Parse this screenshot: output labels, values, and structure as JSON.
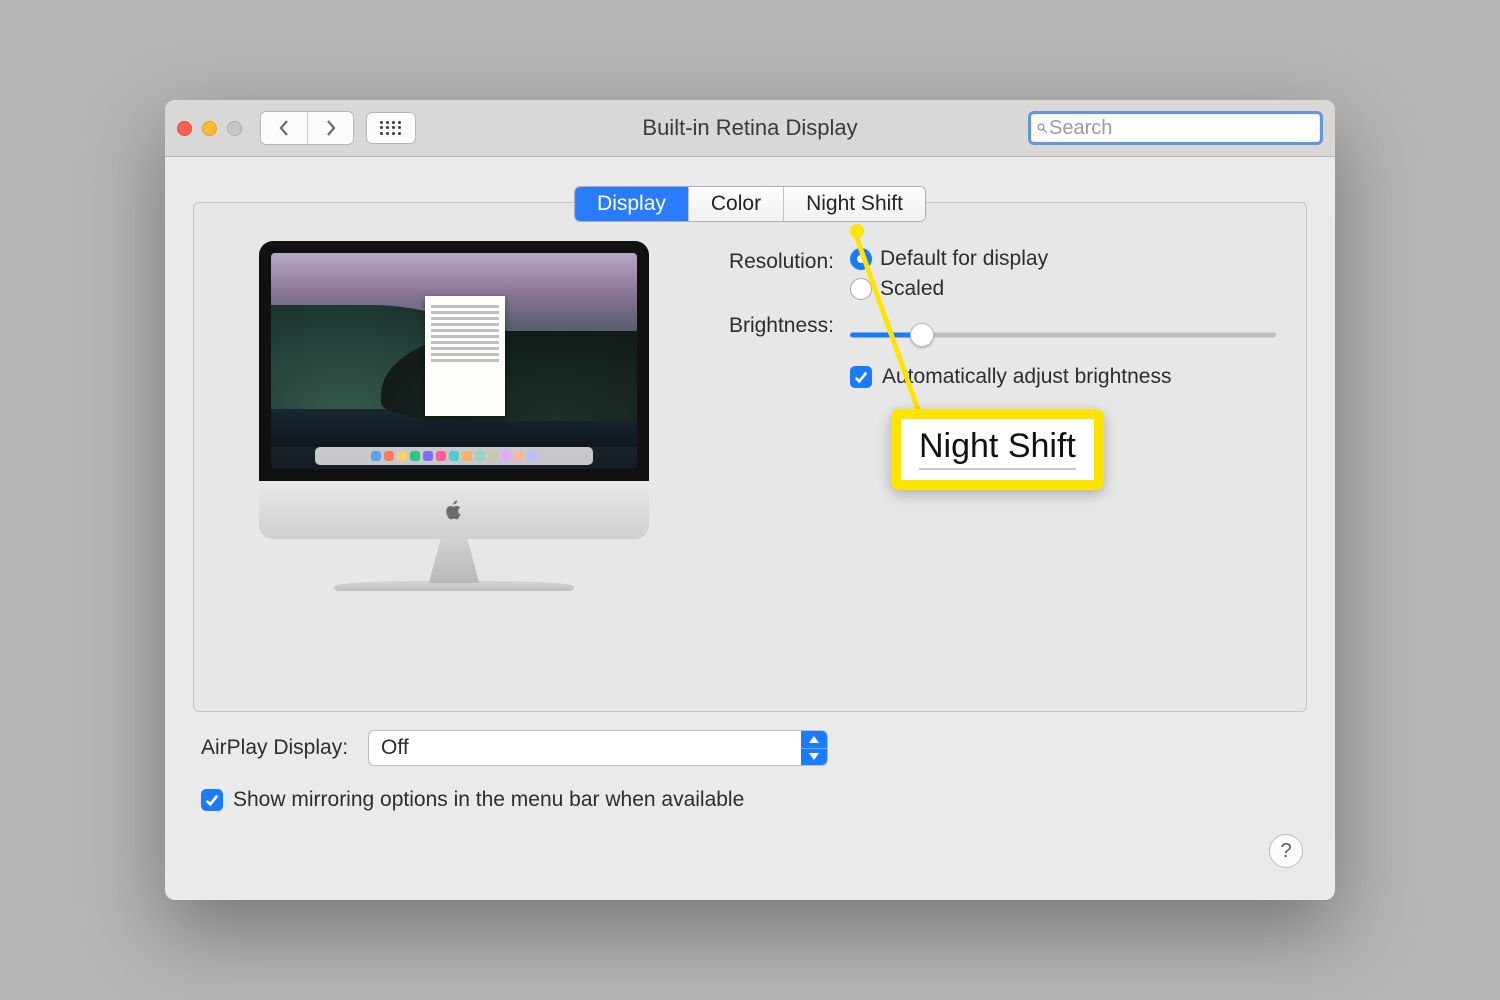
{
  "window": {
    "title": "Built-in Retina Display"
  },
  "search": {
    "placeholder": "Search"
  },
  "tabs": {
    "display": "Display",
    "color": "Color",
    "night_shift": "Night Shift",
    "active": "display"
  },
  "resolution": {
    "label": "Resolution:",
    "default": "Default for display",
    "scaled": "Scaled",
    "selected": "default"
  },
  "brightness": {
    "label": "Brightness:",
    "value_percent": 17,
    "auto_label": "Automatically adjust brightness",
    "auto_checked": true
  },
  "callout": {
    "text": "Night Shift"
  },
  "airplay": {
    "label": "AirPlay Display:",
    "value": "Off"
  },
  "mirroring": {
    "label": "Show mirroring options in the menu bar when available",
    "checked": true
  },
  "help": {
    "symbol": "?"
  },
  "dock_colors": [
    "#5aa0e6",
    "#ff7a59",
    "#ffd166",
    "#29c781",
    "#7a6ff0",
    "#ff5f97",
    "#4ecdc4",
    "#f7b267",
    "#9ad3bc",
    "#c9cba3",
    "#e0aaff",
    "#ffb4a2",
    "#b8c0ff"
  ]
}
